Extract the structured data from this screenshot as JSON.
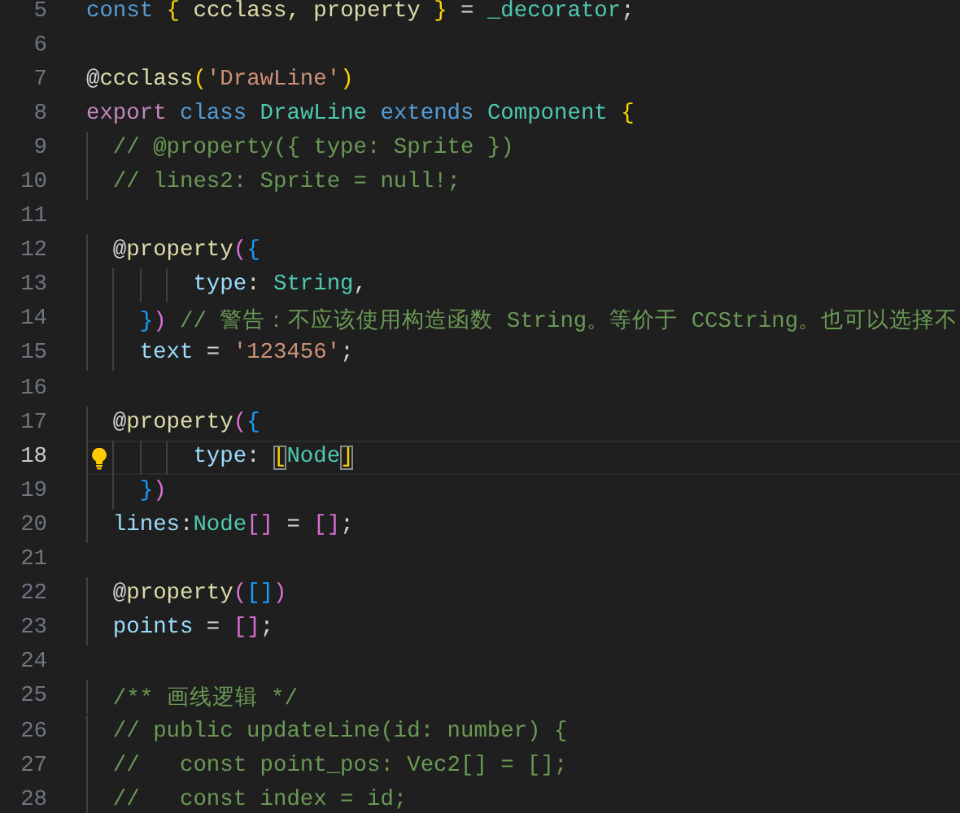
{
  "editor": {
    "lines": [
      {
        "number": "5",
        "current": false,
        "tokens": [
          {
            "text": "const ",
            "kind": "keyword"
          },
          {
            "text": "{",
            "kind": "bracket1"
          },
          {
            "text": " ccclass, property ",
            "kind": "function"
          },
          {
            "text": "}",
            "kind": "bracket1"
          },
          {
            "text": " = ",
            "kind": "plain"
          },
          {
            "text": "_decorator",
            "kind": "type"
          },
          {
            "text": ";",
            "kind": "plain"
          }
        ]
      },
      {
        "number": "6",
        "current": false
      },
      {
        "number": "7",
        "current": false,
        "tokens": [
          {
            "text": "@",
            "kind": "plain"
          },
          {
            "text": "ccclass",
            "kind": "function"
          },
          {
            "text": "(",
            "kind": "bracket1"
          },
          {
            "text": "'DrawLine'",
            "kind": "string"
          },
          {
            "text": ")",
            "kind": "bracket1"
          }
        ]
      },
      {
        "number": "8",
        "current": false,
        "tokens": [
          {
            "text": "export ",
            "kind": "control"
          },
          {
            "text": "class ",
            "kind": "keyword"
          },
          {
            "text": "DrawLine ",
            "kind": "type"
          },
          {
            "text": "extends ",
            "kind": "keyword"
          },
          {
            "text": "Component ",
            "kind": "type"
          },
          {
            "text": "{",
            "kind": "bracket1"
          }
        ]
      },
      {
        "number": "9",
        "current": false,
        "tokens": [
          {
            "text": "  // @property({ type: Sprite })",
            "kind": "comment"
          }
        ]
      },
      {
        "number": "10",
        "current": false,
        "tokens": [
          {
            "text": "  // lines2: Sprite = null!;",
            "kind": "comment"
          }
        ]
      },
      {
        "number": "11",
        "current": false
      },
      {
        "number": "12",
        "current": false,
        "tokens": [
          {
            "text": "  @",
            "kind": "plain"
          },
          {
            "text": "property",
            "kind": "function"
          },
          {
            "text": "(",
            "kind": "bracket2"
          },
          {
            "text": "{",
            "kind": "bracket3"
          }
        ]
      },
      {
        "number": "13",
        "current": false,
        "tokens": [
          {
            "text": "        type",
            "kind": "variable"
          },
          {
            "text": ": ",
            "kind": "plain"
          },
          {
            "text": "String",
            "kind": "type"
          },
          {
            "text": ",",
            "kind": "plain"
          }
        ]
      },
      {
        "number": "14",
        "current": false,
        "tokens": [
          {
            "text": "    }",
            "kind": "bracket3"
          },
          {
            "text": ")",
            "kind": "bracket2"
          },
          {
            "text": " // 警告：不应该使用构造函数 String。等价于 CCString。也可以选择不",
            "kind": "comment"
          }
        ]
      },
      {
        "number": "15",
        "current": false,
        "tokens": [
          {
            "text": "    text",
            "kind": "variable"
          },
          {
            "text": " = ",
            "kind": "plain"
          },
          {
            "text": "'123456'",
            "kind": "string"
          },
          {
            "text": ";",
            "kind": "plain"
          }
        ]
      },
      {
        "number": "16",
        "current": false
      },
      {
        "number": "17",
        "current": false,
        "tokens": [
          {
            "text": "  @",
            "kind": "plain"
          },
          {
            "text": "property",
            "kind": "function"
          },
          {
            "text": "(",
            "kind": "bracket2"
          },
          {
            "text": "{",
            "kind": "bracket3"
          }
        ]
      },
      {
        "number": "18",
        "current": true,
        "tokens": [
          {
            "text": "        type",
            "kind": "variable"
          },
          {
            "text": ": ",
            "kind": "plain"
          },
          {
            "text": "[",
            "kind": "matched"
          },
          {
            "text": "Node",
            "kind": "type"
          },
          {
            "text": "]",
            "kind": "matched"
          }
        ]
      },
      {
        "number": "19",
        "current": false,
        "tokens": [
          {
            "text": "    }",
            "kind": "bracket3"
          },
          {
            "text": ")",
            "kind": "bracket2"
          }
        ]
      },
      {
        "number": "20",
        "current": false,
        "tokens": [
          {
            "text": "  lines",
            "kind": "variable"
          },
          {
            "text": ":",
            "kind": "plain"
          },
          {
            "text": "Node",
            "kind": "type"
          },
          {
            "text": "[]",
            "kind": "bracket2"
          },
          {
            "text": " = ",
            "kind": "plain"
          },
          {
            "text": "[]",
            "kind": "bracket2"
          },
          {
            "text": ";",
            "kind": "plain"
          }
        ]
      },
      {
        "number": "21",
        "current": false
      },
      {
        "number": "22",
        "current": false,
        "tokens": [
          {
            "text": "  @",
            "kind": "plain"
          },
          {
            "text": "property",
            "kind": "function"
          },
          {
            "text": "(",
            "kind": "bracket2"
          },
          {
            "text": "[]",
            "kind": "bracket3"
          },
          {
            "text": ")",
            "kind": "bracket2"
          }
        ]
      },
      {
        "number": "23",
        "current": false,
        "tokens": [
          {
            "text": "  points",
            "kind": "variable"
          },
          {
            "text": " = ",
            "kind": "plain"
          },
          {
            "text": "[]",
            "kind": "bracket2"
          },
          {
            "text": ";",
            "kind": "plain"
          }
        ]
      },
      {
        "number": "24",
        "current": false
      },
      {
        "number": "25",
        "current": false,
        "tokens": [
          {
            "text": "  /** 画线逻辑 */",
            "kind": "comment"
          }
        ]
      },
      {
        "number": "26",
        "current": false,
        "tokens": [
          {
            "text": "  // public updateLine(id: number) {",
            "kind": "comment"
          }
        ]
      },
      {
        "number": "27",
        "current": false,
        "tokens": [
          {
            "text": "  //   const point_pos: Vec2[] = [];",
            "kind": "comment"
          }
        ]
      },
      {
        "number": "28",
        "current": false,
        "tokens": [
          {
            "text": "  //   const index = id;",
            "kind": "comment"
          }
        ]
      }
    ]
  }
}
